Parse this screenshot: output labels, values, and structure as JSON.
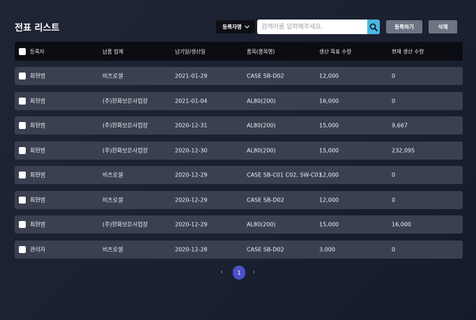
{
  "page": {
    "title": "전표 리스트"
  },
  "filter": {
    "selected": "등록자명",
    "search_placeholder": "검색어를 입력해주세요."
  },
  "actions": {
    "register_label": "등록하기",
    "delete_label": "삭제"
  },
  "table": {
    "columns": [
      "등록자",
      "납품 업체",
      "납기일/생산일",
      "품목(품목명)",
      "생산 목표 수량",
      "현재 생산 수량"
    ],
    "rows": [
      [
        "최현범",
        "비츠로셀",
        "2021-01-29",
        "CASE SB-D02",
        "12,000",
        "0"
      ],
      [
        "최현범",
        "(주)한화보은사업장",
        "2021-01-04",
        "AL80(200)",
        "16,000",
        "0"
      ],
      [
        "최현범",
        "(주)한화보은사업장",
        "2020-12-31",
        "AL80(200)",
        "15,000",
        "9,667"
      ],
      [
        "최현범",
        "(주)한화보은사업장",
        "2020-12-30",
        "AL80(200)",
        "15,000",
        "232,095"
      ],
      [
        "최현범",
        "비츠로셀",
        "2020-12-29",
        "CASE SB-C01 C02, SW-C03",
        "12,000",
        "0"
      ],
      [
        "최현범",
        "비츠로셀",
        "2020-12-29",
        "CASE SB-D02",
        "12,000",
        "0"
      ],
      [
        "최현범",
        "(주)한화보은사업장",
        "2020-12-29",
        "AL80(200)",
        "15,000",
        "16,000"
      ],
      [
        "관리자",
        "비츠로셀",
        "2020-12-28",
        "CASE SB-D02",
        "3,000",
        "0"
      ]
    ]
  },
  "pagination": {
    "prev": "‹",
    "current": "1",
    "next": "›"
  },
  "colors": {
    "accent": "#4b52c9",
    "search_button": "#4ab8e0",
    "row_bg": "#3a4050",
    "header_bg": "#0b0d12"
  },
  "icons": {
    "search": "search-icon",
    "dropdown": "chevron-down-icon"
  }
}
